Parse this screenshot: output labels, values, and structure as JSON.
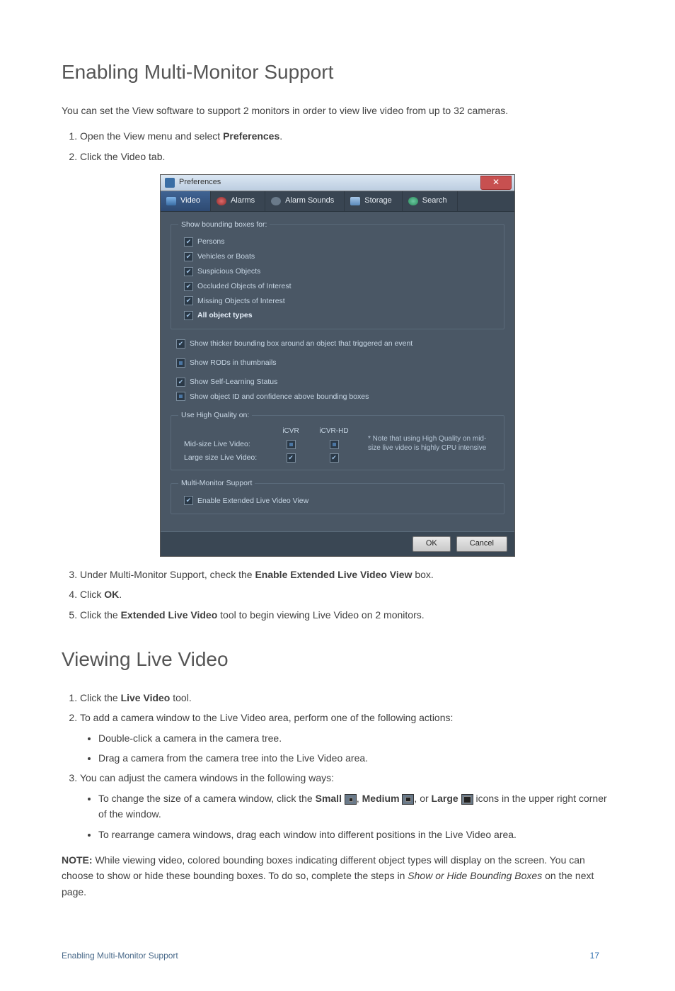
{
  "section1": {
    "title": "Enabling Multi-Monitor Support",
    "intro": "You can set the View software to support 2 monitors in order to view live video from up to 32 cameras.",
    "steps": {
      "s1a": "Open the View menu and select ",
      "s1b": "Preferences",
      "s1c": ".",
      "s2": "Click the Video tab.",
      "s3a": "Under Multi-Monitor Support, check the ",
      "s3b": "Enable Extended Live Video View",
      "s3c": " box.",
      "s4a": "Click ",
      "s4b": "OK",
      "s4c": ".",
      "s5a": "Click the ",
      "s5b": "Extended Live Video",
      "s5c": " tool to begin viewing Live Video on 2 monitors."
    }
  },
  "dialog": {
    "title": "Preferences",
    "tabs": {
      "video": "Video",
      "alarms": "Alarms",
      "alarm_sounds": "Alarm Sounds",
      "storage": "Storage",
      "search": "Search"
    },
    "group_bb": {
      "legend": "Show bounding boxes for:",
      "persons": "Persons",
      "vehicles": "Vehicles or Boats",
      "suspicious": "Suspicious Objects",
      "occluded": "Occluded Objects of Interest",
      "missing": "Missing Objects of Interest",
      "alltypes": "All object types"
    },
    "single": {
      "thicker": "Show thicker bounding box around an object that triggered an event",
      "rods": "Show RODs in thumbnails",
      "selflearn": "Show Self-Learning Status",
      "objid": "Show object ID and confidence above bounding boxes"
    },
    "hq": {
      "legend": "Use High Quality on:",
      "col1": "iCVR",
      "col2": "iCVR-HD",
      "row1": "Mid-size Live Video:",
      "row2": "Large size Live Video:",
      "note": "* Note that using High Quality on mid-size live video is highly CPU intensive"
    },
    "multi": {
      "legend": "Multi-Monitor Support",
      "enable": "Enable Extended Live Video View"
    },
    "buttons": {
      "ok": "OK",
      "cancel": "Cancel"
    }
  },
  "section2": {
    "title": "Viewing Live Video",
    "s1a": "Click the ",
    "s1b": "Live Video",
    "s1c": " tool.",
    "s2": "To add a camera window to the Live Video area, perform one of the following actions:",
    "s2a": "Double-click a camera in the camera tree.",
    "s2b": "Drag a camera from the camera tree into the Live Video area.",
    "s3": "You can adjust the camera windows in the following ways:",
    "s3a_1": "To change the size of a camera window, click the ",
    "s3a_small": "Small",
    "s3a_2": ", ",
    "s3a_medium": "Medium",
    "s3a_3": ", or ",
    "s3a_large": "Large",
    "s3a_4": " icons in the upper right corner of the window.",
    "s3b": "To rearrange camera windows, drag each window into different positions in the Live Video area."
  },
  "note": {
    "label": "NOTE:",
    "text1": " While viewing video, colored bounding boxes indicating different object types will display on the screen. You can choose to show or hide these bounding boxes. To do so, complete the steps in ",
    "italic": "Show or Hide Bounding Boxes",
    "text2": " on the next page."
  },
  "footer": {
    "left": "Enabling Multi-Monitor Support",
    "page": "17"
  }
}
